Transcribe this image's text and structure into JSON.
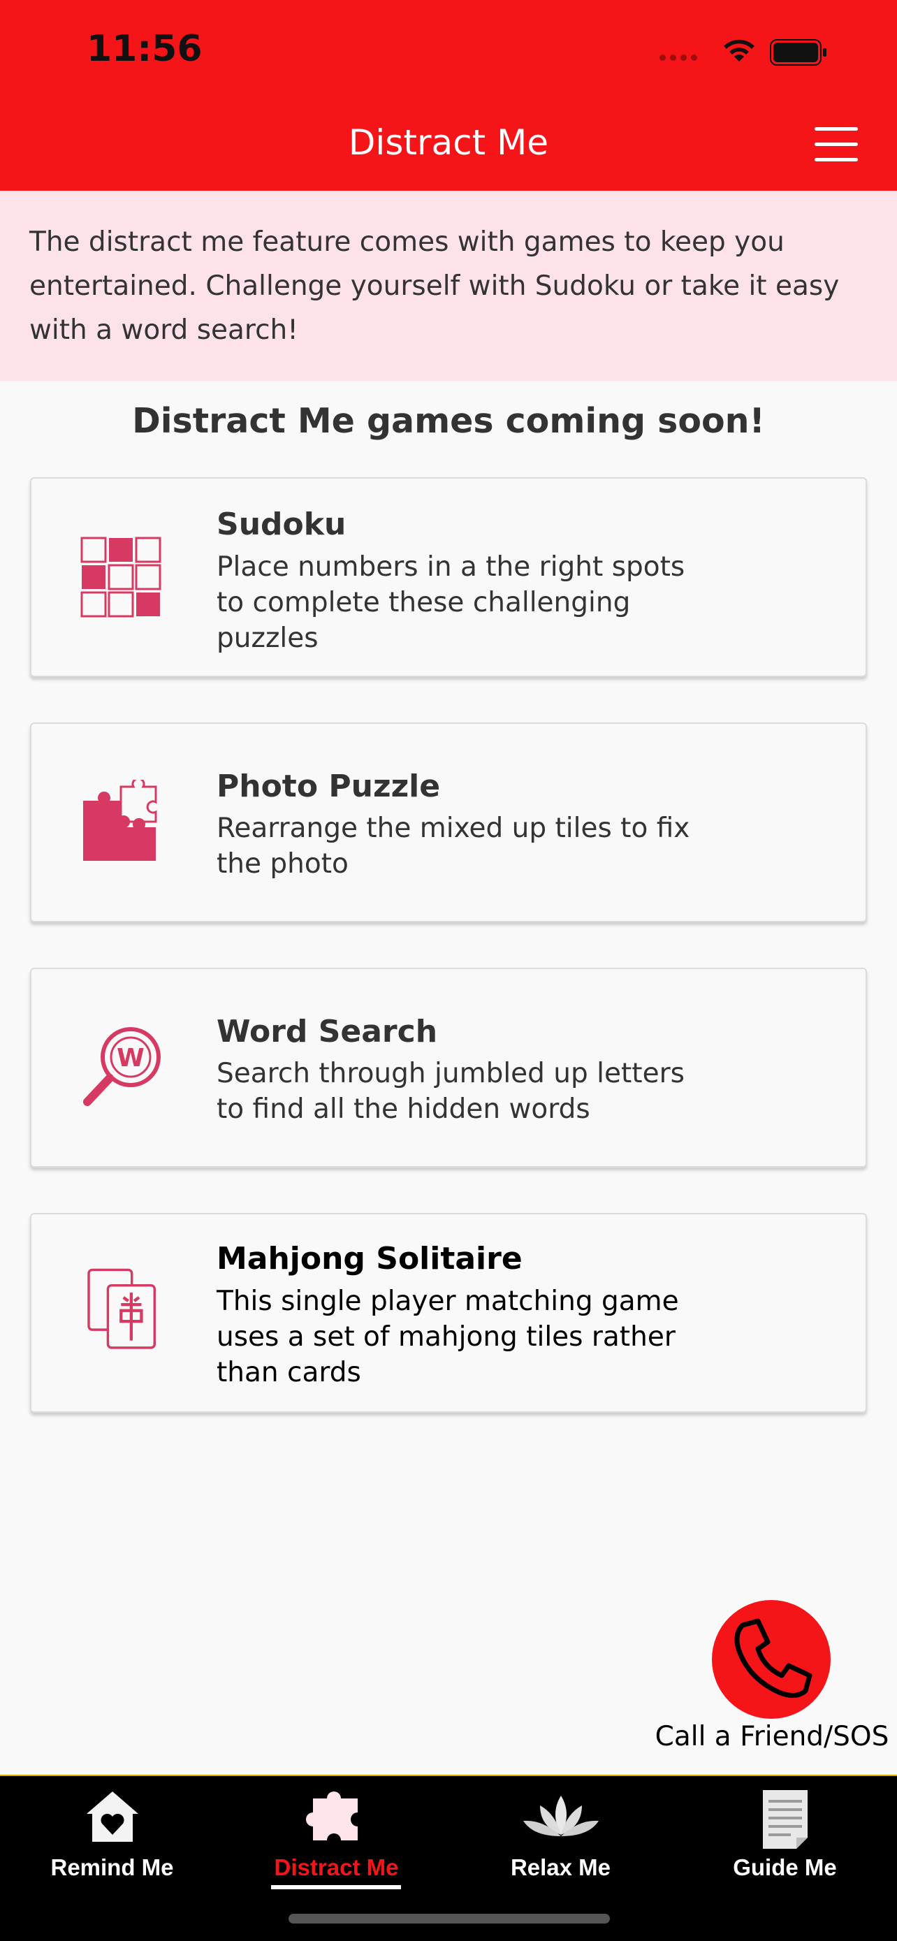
{
  "status_bar": {
    "time": "11:56"
  },
  "header": {
    "title": "Distract Me",
    "menu_icon": "hamburger-menu-icon"
  },
  "intro": {
    "text": "The distract me feature comes with games to keep you entertained. Challenge yourself with Sudoku or take it easy with a word search!"
  },
  "section_title": "Distract Me games coming soon!",
  "games": [
    {
      "title": "Sudoku",
      "description": "Place numbers in a the right spots to complete these challenging puzzles",
      "icon": "sudoku-grid-icon"
    },
    {
      "title": "Photo Puzzle",
      "description": "Rearrange the mixed up tiles to fix the photo",
      "icon": "puzzle-pieces-icon"
    },
    {
      "title": "Word Search",
      "description": "Search through jumbled up letters to find all the hidden words",
      "icon": "magnifier-w-icon"
    },
    {
      "title": "Mahjong Solitaire",
      "description": "This single player matching game uses a set of mahjong tiles rather than cards",
      "icon": "mahjong-tiles-icon"
    }
  ],
  "call_button": {
    "label": "Call a Friend/SOS",
    "icon": "phone-icon"
  },
  "bottom_nav": [
    {
      "label": "Remind Me",
      "icon": "house-heart-icon",
      "active": false
    },
    {
      "label": "Distract Me",
      "icon": "puzzle-piece-icon",
      "active": true
    },
    {
      "label": "Relax Me",
      "icon": "lotus-icon",
      "active": false
    },
    {
      "label": "Guide Me",
      "icon": "document-icon",
      "active": false
    }
  ],
  "colors": {
    "primary_red": "#f51519",
    "accent_pink": "#d63a63",
    "intro_bg": "#fde2ea",
    "nav_bg": "#000000"
  }
}
